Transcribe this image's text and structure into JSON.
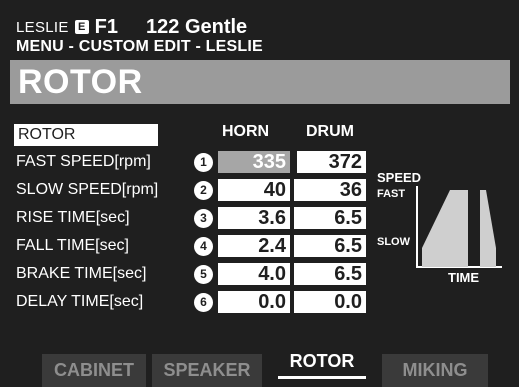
{
  "header": {
    "leslie_label": "LESLIE",
    "e_badge": "E",
    "patch_id": "F1",
    "patch_name": "122 Gentle",
    "menu_path": "MENU - CUSTOM EDIT - LESLIE",
    "title": "ROTOR"
  },
  "table": {
    "selected_label": "ROTOR",
    "col_horn": "HORN",
    "col_drum": "DRUM",
    "rows": [
      {
        "label": "FAST SPEED[rpm]",
        "num": "1",
        "horn": "335",
        "drum": "372"
      },
      {
        "label": "SLOW SPEED[rpm]",
        "num": "2",
        "horn": "40",
        "drum": "36"
      },
      {
        "label": "RISE TIME[sec]",
        "num": "3",
        "horn": "3.6",
        "drum": "6.5"
      },
      {
        "label": "FALL TIME[sec]",
        "num": "4",
        "horn": "2.4",
        "drum": "6.5"
      },
      {
        "label": "BRAKE TIME[sec]",
        "num": "5",
        "horn": "4.0",
        "drum": "6.5"
      },
      {
        "label": "DELAY TIME[sec]",
        "num": "6",
        "horn": "0.0",
        "drum": "0.0"
      }
    ]
  },
  "graph": {
    "speed_label": "SPEED",
    "fast_label": "FAST",
    "slow_label": "SLOW",
    "time_label": "TIME"
  },
  "tabs": [
    {
      "label": "CABINET",
      "active": false
    },
    {
      "label": "SPEAKER",
      "active": false
    },
    {
      "label": "ROTOR",
      "active": true
    },
    {
      "label": "MIKING",
      "active": false
    }
  ],
  "colors": {
    "background": "#1f1f1f",
    "title_bar": "#9b9b9b",
    "highlight_cell": "#a6a6a6",
    "text": "#ffffff"
  }
}
